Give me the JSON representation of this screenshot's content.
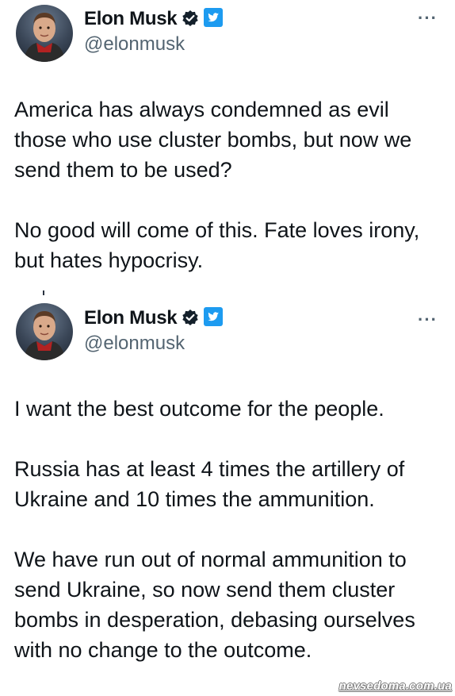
{
  "tweets": [
    {
      "author_name": "Elon Musk",
      "handle": "@elonmusk",
      "more_label": "···",
      "paragraphs": [
        "America has always condemned as evil those who use cluster bombs, but now we send them to be used?",
        "No good will come of this. Fate loves irony, but hates hypocrisy."
      ]
    },
    {
      "author_name": "Elon Musk",
      "handle": "@elonmusk",
      "more_label": "···",
      "paragraphs": [
        "I want the best outcome for the people.",
        "Russia has at least 4 times the artillery of Ukraine and 10 times the ammunition.",
        "We have run out of normal ammunition to send Ukraine, so now send them cluster bombs in desperation, debasing ourselves with no change to the outcome."
      ]
    }
  ],
  "icons": {
    "verified": "verified-badge-icon",
    "bird": "twitter-bird-icon",
    "more": "more-options-icon"
  },
  "colors": {
    "verified_blue": "#1d9bf0",
    "handle_gray": "#536471",
    "text": "#0f1419"
  },
  "watermark": "nevsedoma.com.ua"
}
